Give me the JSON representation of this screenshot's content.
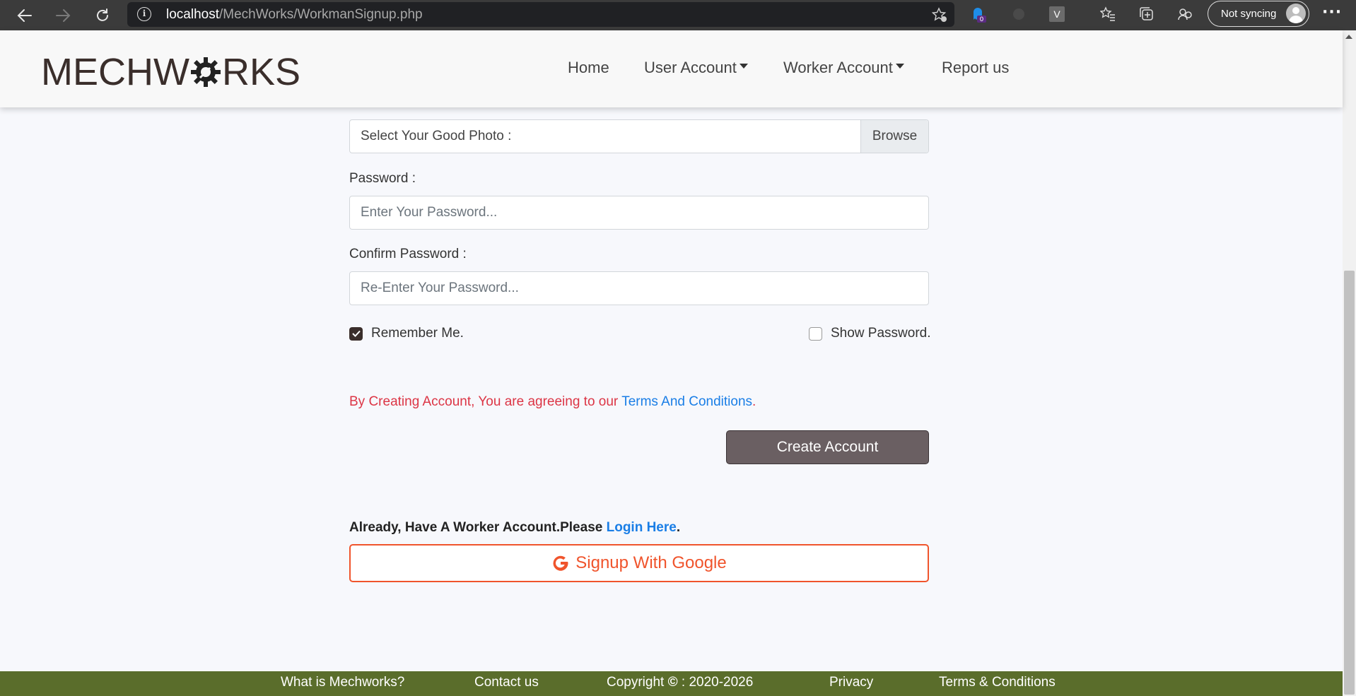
{
  "browser": {
    "url_host": "localhost",
    "url_path": "/MechWorks/WorkmanSignup.php",
    "ext_badge_count": "0",
    "ext_v_label": "V",
    "sync_label": "Not syncing",
    "more_label": "···"
  },
  "site": {
    "logo_text_start": "MECHW",
    "logo_text_end": "RKS",
    "nav": {
      "home": "Home",
      "user_account": "User Account",
      "worker_account": "Worker Account",
      "report": "Report us"
    }
  },
  "form": {
    "photo_label": "Select Your Good Photo :",
    "browse_label": "Browse",
    "password_label": "Password :",
    "password_placeholder": "Enter Your Password...",
    "confirm_label": "Confirm Password :",
    "confirm_placeholder": "Re-Enter Your Password...",
    "remember_label": "Remember Me.",
    "remember_checked": true,
    "show_password_label": "Show Password.",
    "show_password_checked": false,
    "terms_prefix": "By Creating Account, You are agreeing to our ",
    "terms_link": "Terms And Conditions",
    "terms_suffix": ".",
    "create_button": "Create Account",
    "already_prefix": "Already, Have A Worker Account.Please ",
    "login_link": "Login Here",
    "already_suffix": ".",
    "google_button": "Signup With Google"
  },
  "footer": {
    "what_is": "What is Mechworks?",
    "contact": "Contact us",
    "copyright": "Copyright",
    "copyright_symbol": "©",
    "copyright_years": " : 2020-2026",
    "privacy": "Privacy",
    "terms": "Terms & Conditions"
  },
  "colors": {
    "footer_bg": "#5a6d2b",
    "create_btn_bg": "#6a5f62",
    "google_accent": "#f0542c",
    "link": "#1a7ee6",
    "terms_text": "#dc3545"
  }
}
